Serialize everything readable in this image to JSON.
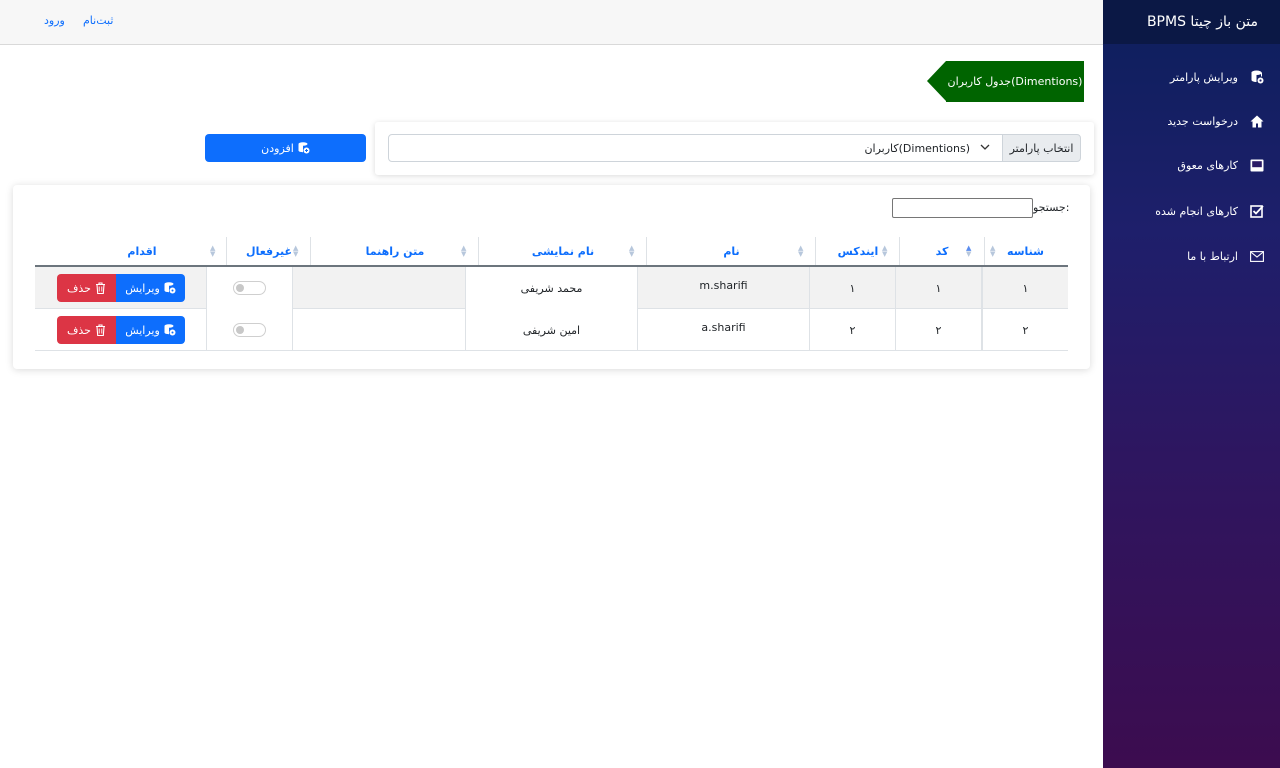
{
  "sidebar": {
    "title": "BPMS متن باز چیتا",
    "items": [
      {
        "label": "ویرایش پارامتر",
        "icon": "database-gear-icon"
      },
      {
        "label": "درخواست جدید",
        "icon": "home-icon"
      },
      {
        "label": "کارهای معوق",
        "icon": "inbox-icon"
      },
      {
        "label": "کارهای انجام شده",
        "icon": "check-square-icon"
      },
      {
        "label": "ارتباط با ما",
        "icon": "envelope-icon"
      }
    ]
  },
  "topbar": {
    "register": "ثبت‌نام",
    "login": "ورود"
  },
  "page": {
    "title": "جدول کاربران(Dimentions)"
  },
  "param": {
    "label": "انتخاب پارامتر",
    "selected": "کاربران(Dimentions)"
  },
  "add_button": "افزودن",
  "search": {
    "label": "جستجو:",
    "value": ""
  },
  "table": {
    "columns": [
      "شناسه",
      "کد",
      "ایندکس",
      "نام",
      "نام نمایشی",
      "متن راهنما",
      "غیرفعال",
      "اقدام"
    ],
    "rows": [
      {
        "id": "۱",
        "code": "۱",
        "index": "۱",
        "name": "m.sharifi",
        "display": "محمد شریفی",
        "help": "",
        "inactive": false
      },
      {
        "id": "۲",
        "code": "۲",
        "index": "۲",
        "name": "a.sharifi",
        "display": "امین شریفی",
        "help": "",
        "inactive": false
      }
    ],
    "edit_label": "ویرایش",
    "delete_label": "حذف"
  },
  "colors": {
    "primary": "#0d6efd",
    "danger": "#dc3545",
    "ribbon": "#006400",
    "sidebar_top": "#0c1f5c",
    "sidebar_bottom": "#3c0c4f"
  }
}
